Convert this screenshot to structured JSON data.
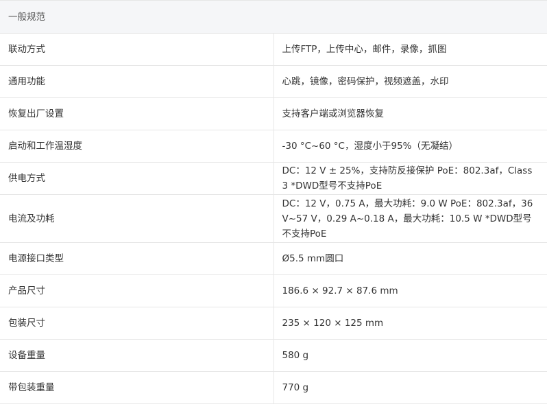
{
  "section_title": "一般规范",
  "rows": [
    {
      "label": "联动方式",
      "value": "上传FTP，上传中心，邮件，录像，抓图"
    },
    {
      "label": "通用功能",
      "value": "心跳，镜像，密码保护，视频遮盖，水印"
    },
    {
      "label": "恢复出厂设置",
      "value": "支持客户端或浏览器恢复"
    },
    {
      "label": "启动和工作温湿度",
      "value": "-30 °C~60 °C，湿度小于95%（无凝结）"
    },
    {
      "label": "供电方式",
      "value": "DC：12 V ± 25%，支持防反接保护 PoE：802.3af，Class 3 *DWD型号不支持PoE"
    },
    {
      "label": "电流及功耗",
      "value": "DC：12 V，0.75 A，最大功耗：9.0 W PoE：802.3af，36 V~57 V，0.29 A~0.18 A，最大功耗：10.5 W *DWD型号不支持PoE"
    },
    {
      "label": "电源接口类型",
      "value": "Ø5.5 mm圆口"
    },
    {
      "label": "产品尺寸",
      "value": "186.6 × 92.7 × 87.6 mm"
    },
    {
      "label": "包装尺寸",
      "value": "235 × 120 × 125 mm"
    },
    {
      "label": "设备重量",
      "value": "580 g"
    },
    {
      "label": "带包装重量",
      "value": "770 g"
    }
  ]
}
